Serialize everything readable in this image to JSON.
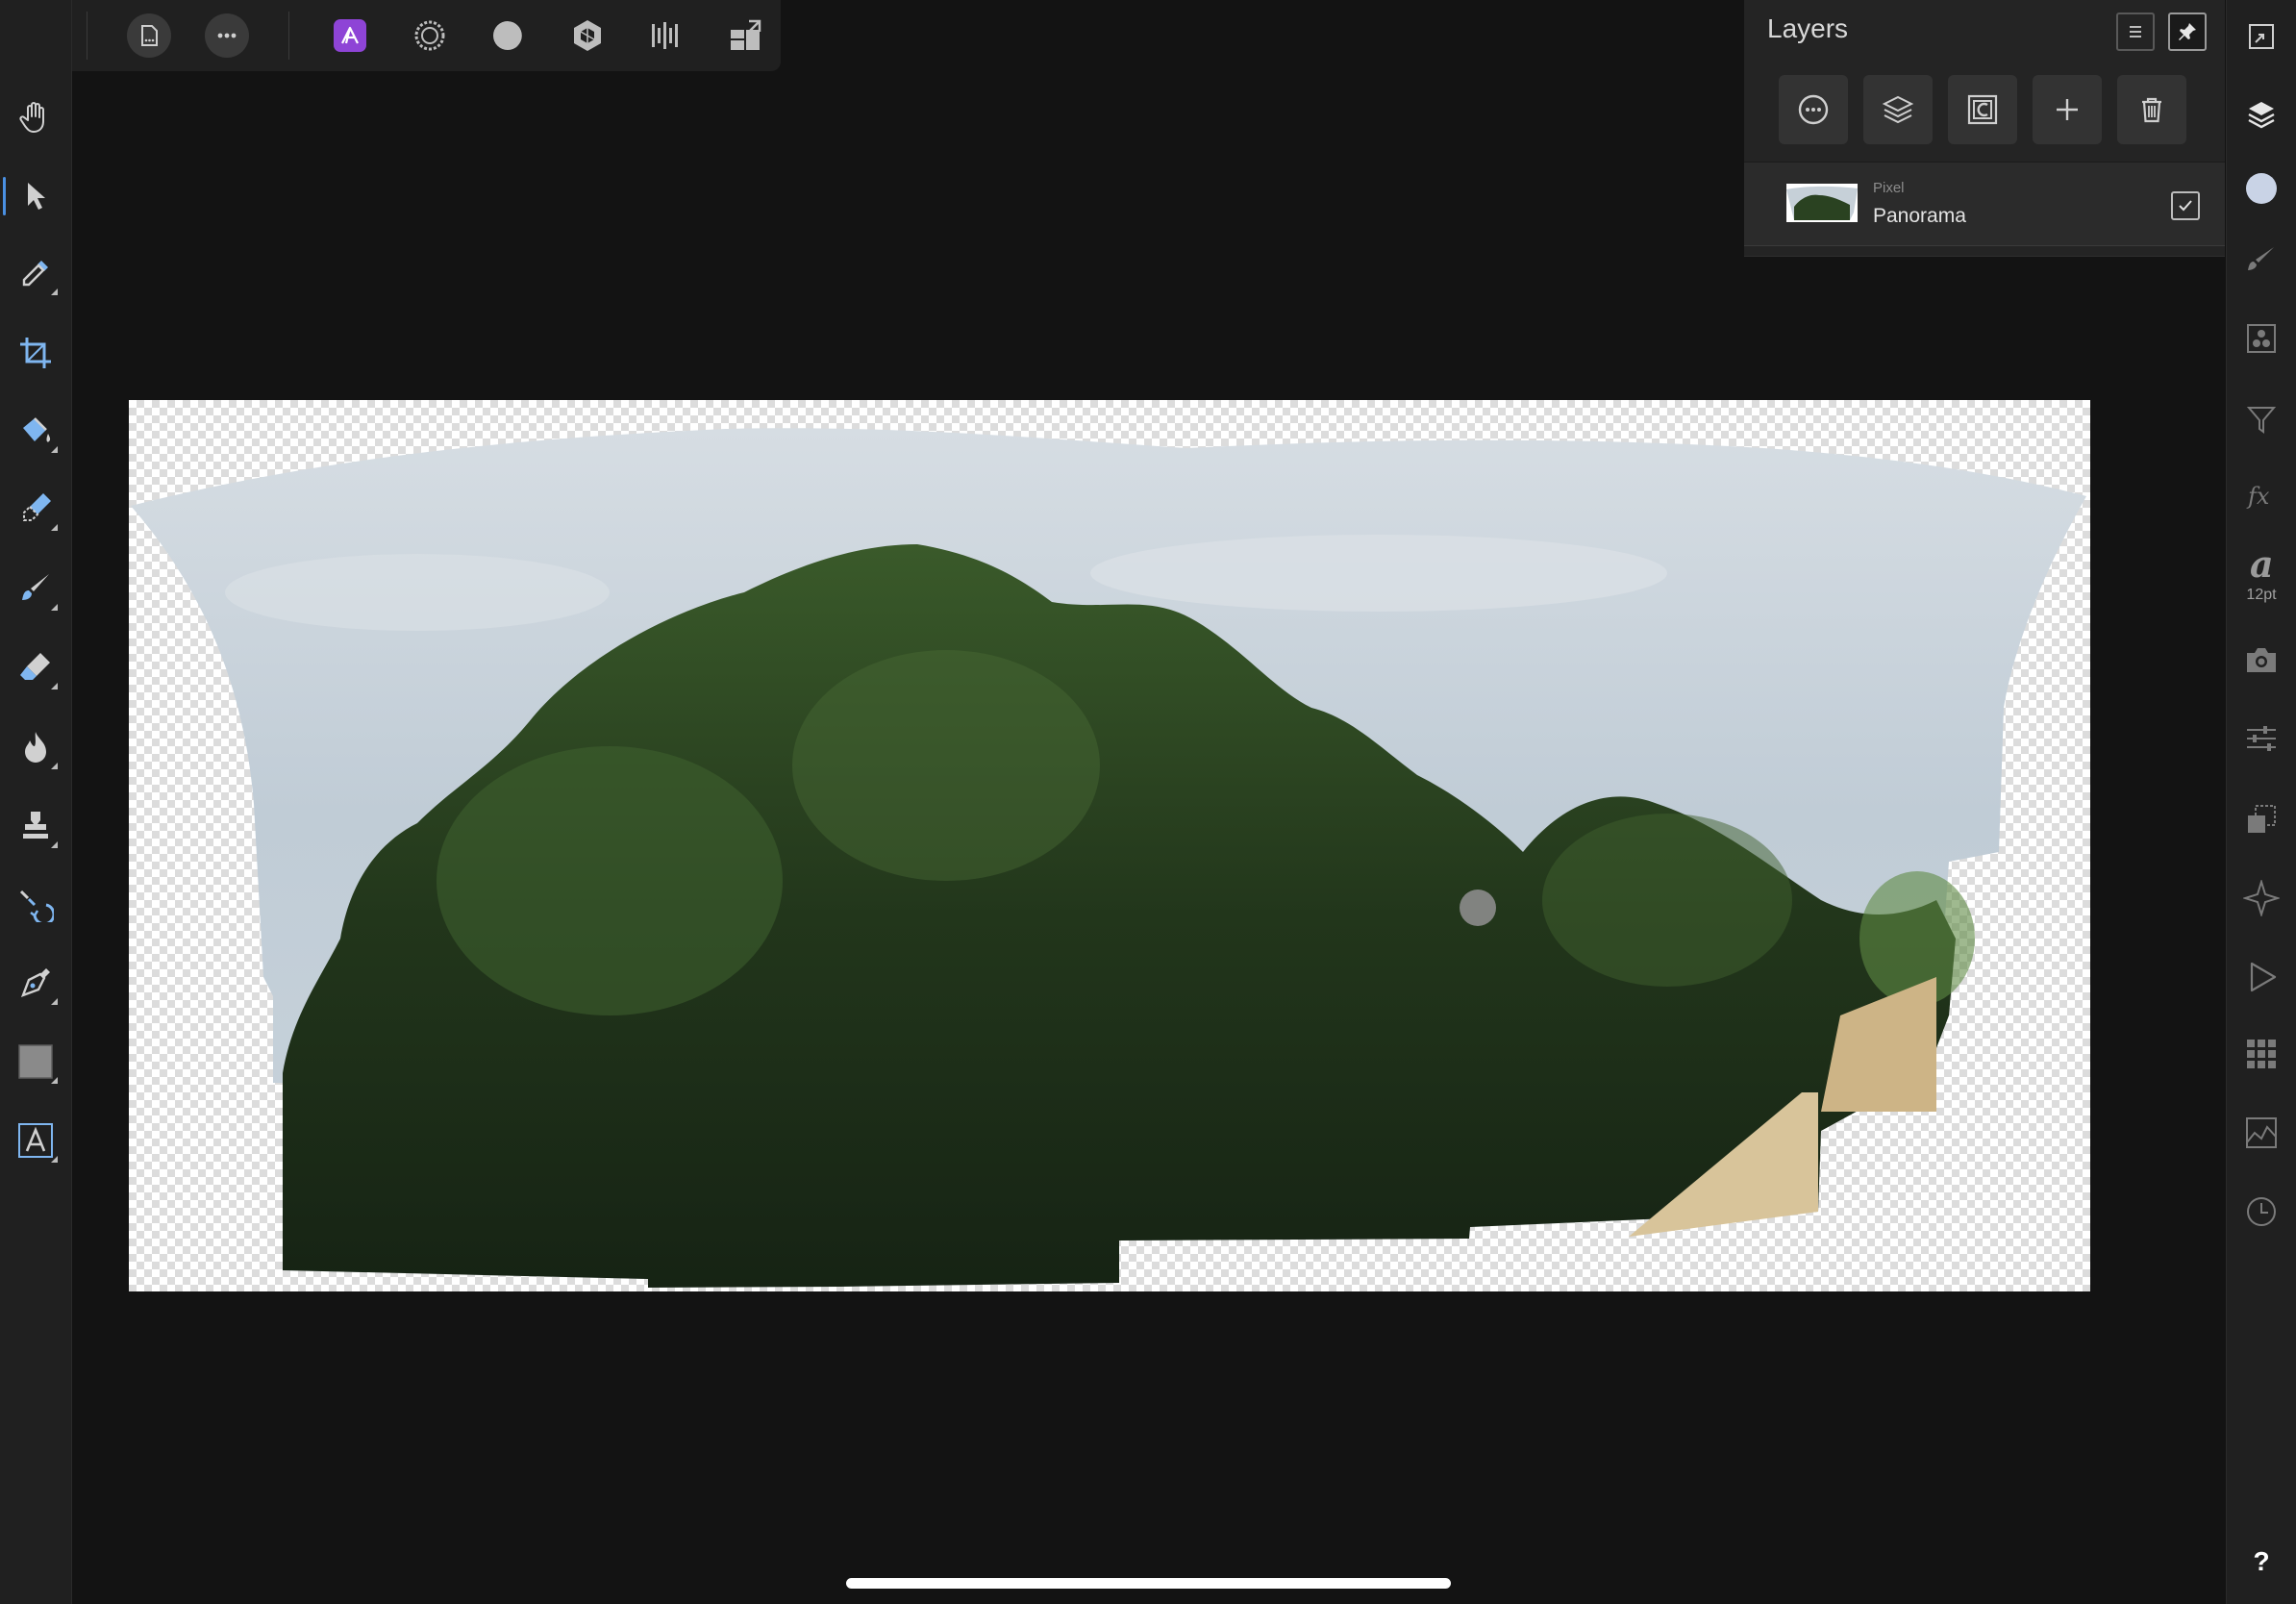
{
  "layers_panel": {
    "title": "Layers",
    "layers": [
      {
        "type": "Pixel",
        "name": "Panorama",
        "visible": true
      }
    ]
  },
  "studio": {
    "text_size_label": "12pt",
    "help_label": "?"
  },
  "colors": {
    "accent": "#4a90e2",
    "persona_photo": "#8e44d6",
    "background": "#131313",
    "panel": "#242424"
  }
}
